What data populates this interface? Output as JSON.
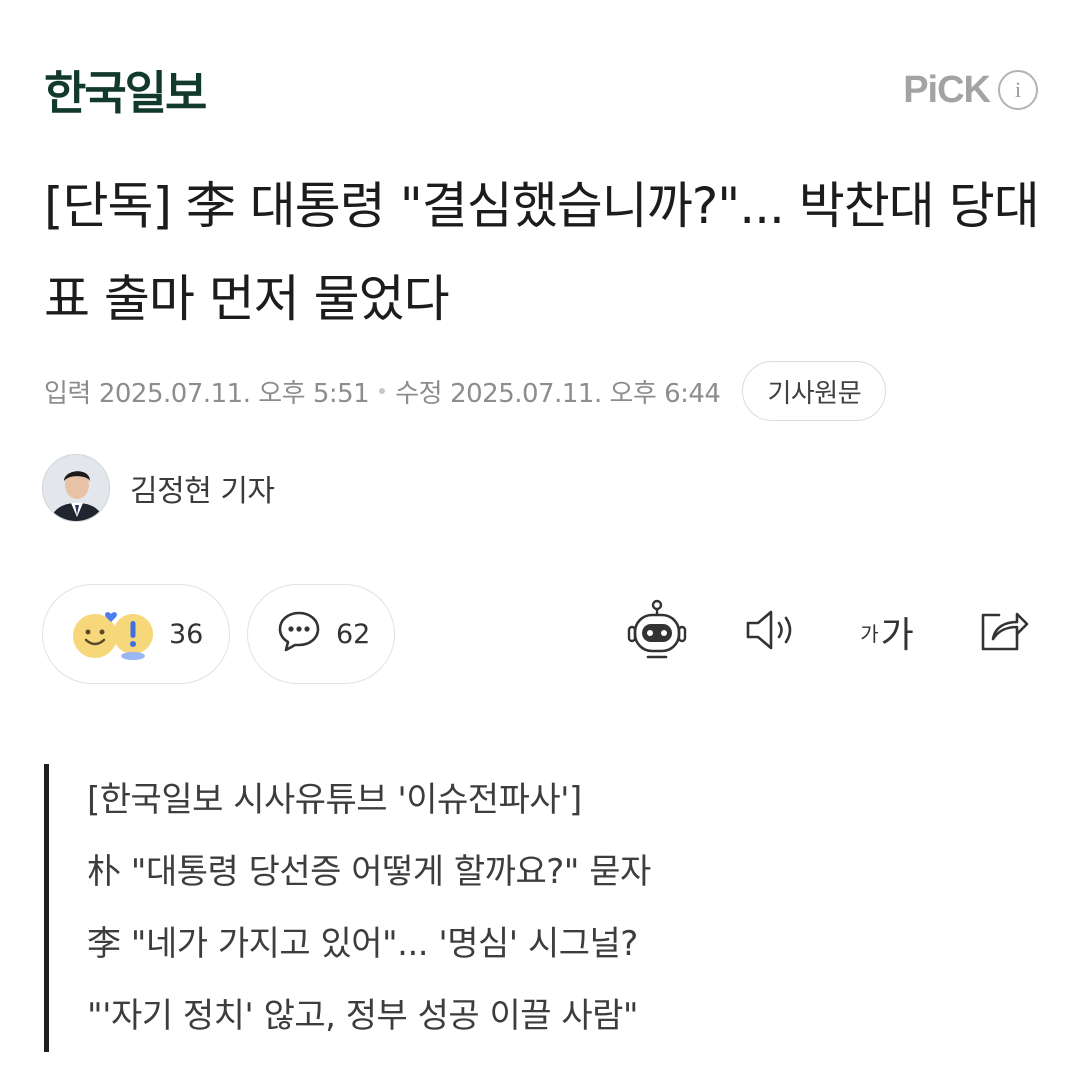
{
  "header": {
    "logo": "한국일보",
    "pick_label": "PiCK",
    "info_icon": "i"
  },
  "article": {
    "headline": "[단독] 李 대통령 \"결심했습니까?\"... 박찬대 당대표 출마 먼저 물었다",
    "input_label": "입력",
    "input_time": "2025.07.11. 오후 5:51",
    "edit_label": "수정",
    "edit_time": "2025.07.11. 오후 6:44",
    "original_button": "기사원문"
  },
  "reporter": {
    "name": "김정현 기자"
  },
  "actions": {
    "reaction_count": "36",
    "comment_count": "62",
    "font_small": "가",
    "font_large": "가"
  },
  "summary": {
    "lines": [
      "[한국일보 시사유튜브 '이슈전파사']",
      "朴 \"대통령 당선증 어떻게 할까요?\" 묻자",
      "李 \"네가 가지고 있어\"... '명심' 시그널?",
      "\"'자기 정치' 않고, 정부 성공 이끌 사람\""
    ]
  },
  "colors": {
    "logo": "#123a2a",
    "pick": "#a3a3a3",
    "meta": "#8d8d8d",
    "quote_bar": "#1f1f1f"
  }
}
